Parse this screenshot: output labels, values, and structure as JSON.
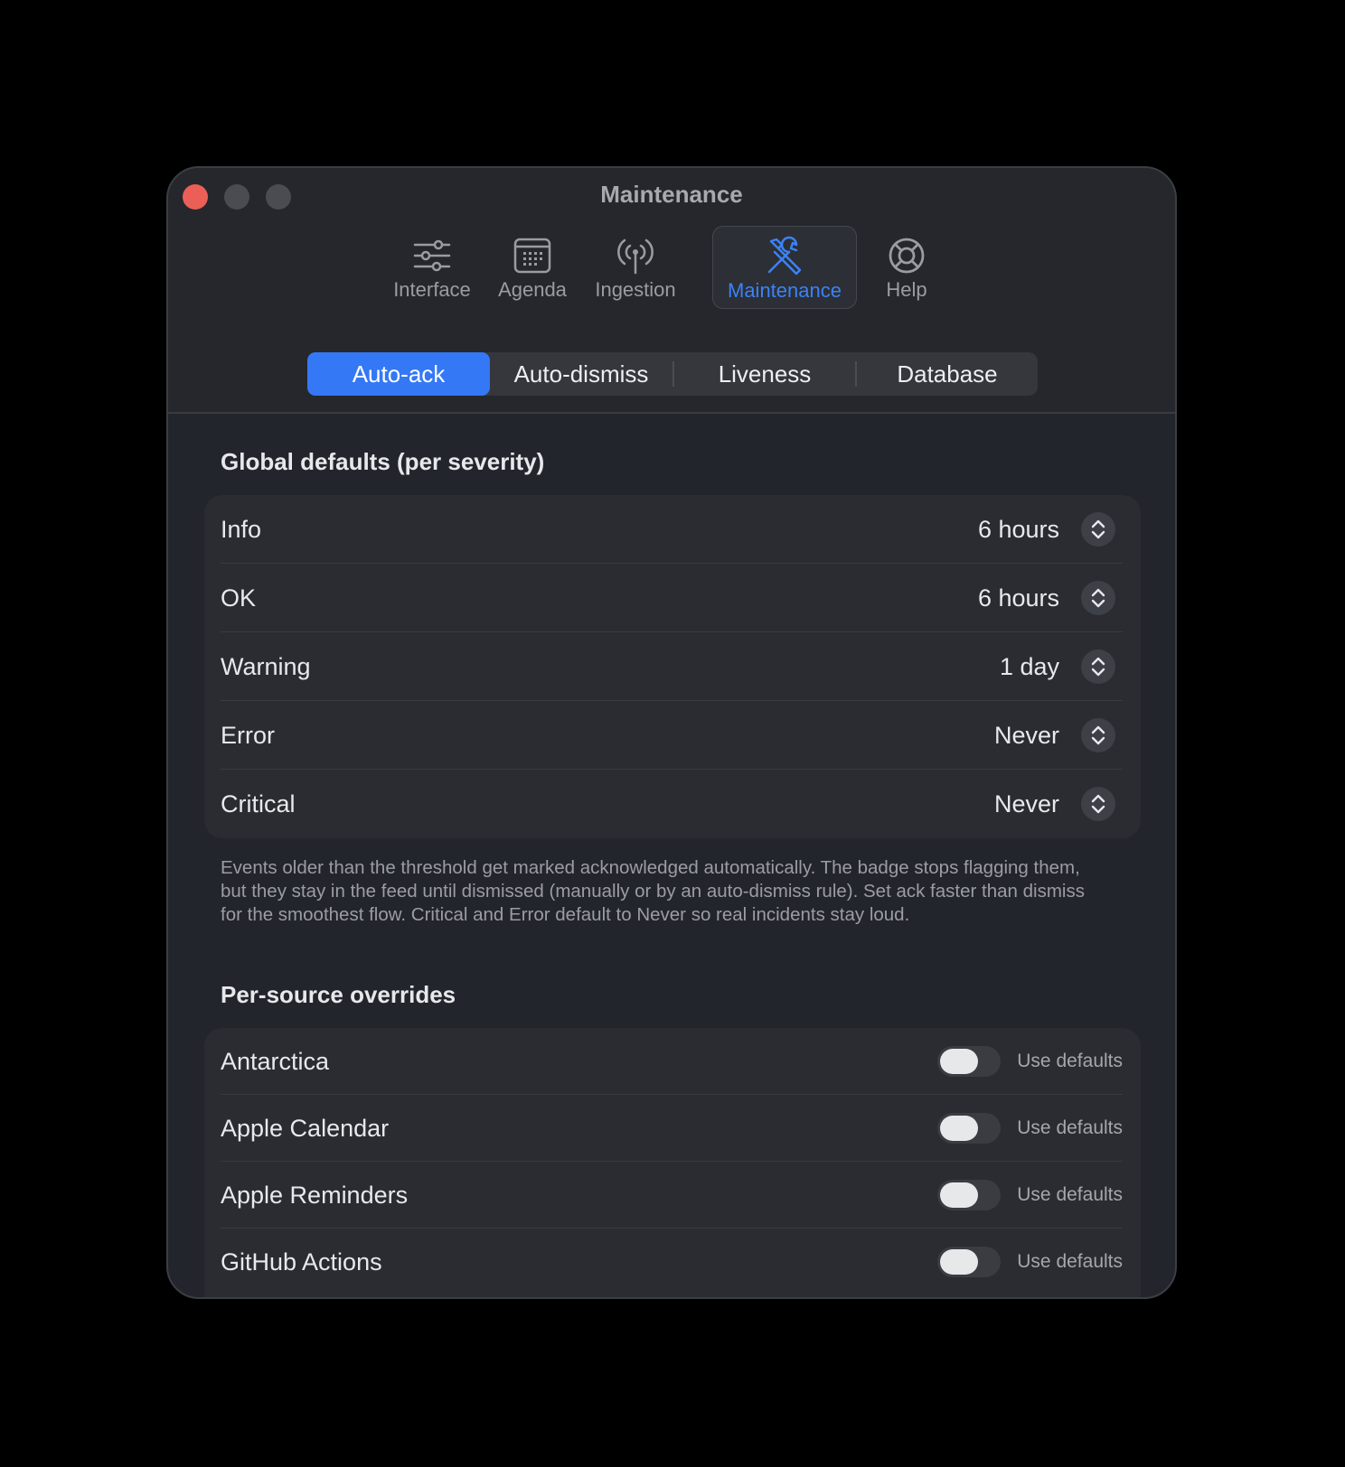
{
  "window": {
    "title": "Maintenance"
  },
  "toolbar": {
    "items": [
      {
        "label": "Interface",
        "icon": "sliders-icon"
      },
      {
        "label": "Agenda",
        "icon": "calendar-icon"
      },
      {
        "label": "Ingestion",
        "icon": "antenna-icon"
      },
      {
        "label": "Maintenance",
        "icon": "tools-icon",
        "active": true
      },
      {
        "label": "Help",
        "icon": "lifebuoy-icon"
      }
    ]
  },
  "tabs": {
    "items": [
      "Auto-ack",
      "Auto-dismiss",
      "Liveness",
      "Database"
    ],
    "selected": "Auto-ack"
  },
  "global": {
    "title": "Global defaults (per severity)",
    "rows": [
      {
        "name": "Info",
        "value": "6 hours"
      },
      {
        "name": "OK",
        "value": "6 hours"
      },
      {
        "name": "Warning",
        "value": "1 day"
      },
      {
        "name": "Error",
        "value": "Never"
      },
      {
        "name": "Critical",
        "value": "Never"
      }
    ],
    "description": "Events older than the threshold get marked acknowledged automatically. The badge stops flagging them, but they stay in the feed until dismissed (manually or by an auto-dismiss rule). Set ack faster than dismiss for the smoothest flow. Critical and Error default to Never so real incidents stay loud."
  },
  "overrides": {
    "title": "Per-source overrides",
    "rows": [
      {
        "name": "Antarctica",
        "toggle_label": "Use defaults",
        "enabled": false
      },
      {
        "name": "Apple Calendar",
        "toggle_label": "Use defaults",
        "enabled": false
      },
      {
        "name": "Apple Reminders",
        "toggle_label": "Use defaults",
        "enabled": false
      },
      {
        "name": "GitHub Actions",
        "toggle_label": "Use defaults",
        "enabled": false
      }
    ]
  },
  "colors": {
    "accent": "#3478f6",
    "window_bg": "#22252b",
    "close": "#ec5f57"
  }
}
